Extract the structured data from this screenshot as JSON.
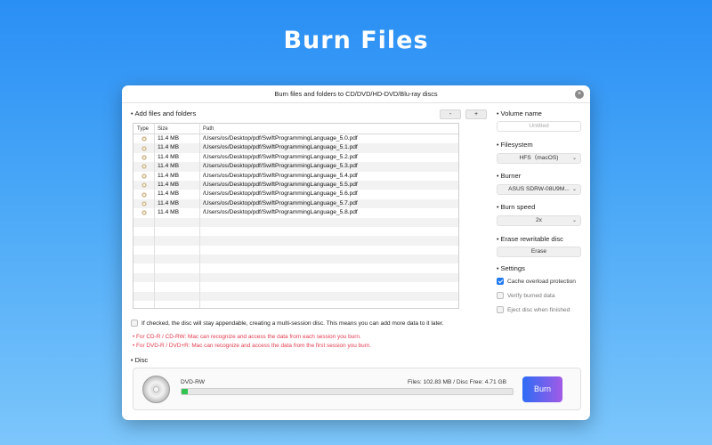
{
  "hero": {
    "title": "Burn Files"
  },
  "window": {
    "title": "Burn files and folders to CD/DVD/HD-DVD/Blu-ray discs",
    "close": "×"
  },
  "add_files": {
    "label": "Add files and folders",
    "remove_label": "-",
    "add_label": "+"
  },
  "table": {
    "headers": [
      "Type",
      "Size",
      "Path"
    ],
    "rows": [
      {
        "size": "11.4 MB",
        "path": "/Users/os/Desktop/pdf/SwiftProgrammingLanguage_5.0.pdf"
      },
      {
        "size": "11.4 MB",
        "path": "/Users/os/Desktop/pdf/SwiftProgrammingLanguage_5.1.pdf"
      },
      {
        "size": "11.4 MB",
        "path": "/Users/os/Desktop/pdf/SwiftProgrammingLanguage_5.2.pdf"
      },
      {
        "size": "11.4 MB",
        "path": "/Users/os/Desktop/pdf/SwiftProgrammingLanguage_5.3.pdf"
      },
      {
        "size": "11.4 MB",
        "path": "/Users/os/Desktop/pdf/SwiftProgrammingLanguage_5.4.pdf"
      },
      {
        "size": "11.4 MB",
        "path": "/Users/os/Desktop/pdf/SwiftProgrammingLanguage_5.5.pdf"
      },
      {
        "size": "11.4 MB",
        "path": "/Users/os/Desktop/pdf/SwiftProgrammingLanguage_5.6.pdf"
      },
      {
        "size": "11.4 MB",
        "path": "/Users/os/Desktop/pdf/SwiftProgrammingLanguage_5.7.pdf"
      },
      {
        "size": "11.4 MB",
        "path": "/Users/os/Desktop/pdf/SwiftProgrammingLanguage_5.8.pdf"
      }
    ]
  },
  "append": {
    "text": "If checked, the disc will stay appendable, creating a multi-session disc. This means you can add more data to it later.",
    "checked": false,
    "note1": "• For CD-R / CD-RW: Mac can recognize and access the data from each session you burn.",
    "note2": "• For DVD-R / DVD+R: Mac can recognize and access the data from the first session you burn."
  },
  "disc": {
    "label": "Disc",
    "type": "DVD-RW",
    "info": "Files: 102.83 MB / Disc Free: 4.71 GB",
    "progress_percent": 2,
    "burn_label": "Burn"
  },
  "settings_panel": {
    "volume_name_label": "Volume name",
    "volume_name_placeholder": "Untitled",
    "filesystem_label": "Filesystem",
    "filesystem_value": "HFS（macOS)",
    "burner_label": "Burner",
    "burner_value": "ASUS SDRW-08U9M...",
    "burn_speed_label": "Burn speed",
    "burn_speed_value": "2x",
    "erase_label": "Erase rewritable disc",
    "erase_button": "Erase",
    "settings_label": "Settings",
    "options": [
      {
        "label": "Cache overload protection",
        "checked": true
      },
      {
        "label": "Verify burned data",
        "checked": false
      },
      {
        "label": "Eject disc when finished",
        "checked": false
      }
    ],
    "chevron": "⌃⌄"
  },
  "colors": {
    "accent": "#1f7af0",
    "warning_text": "#e23a4c",
    "progress_fill": "#31c451"
  }
}
